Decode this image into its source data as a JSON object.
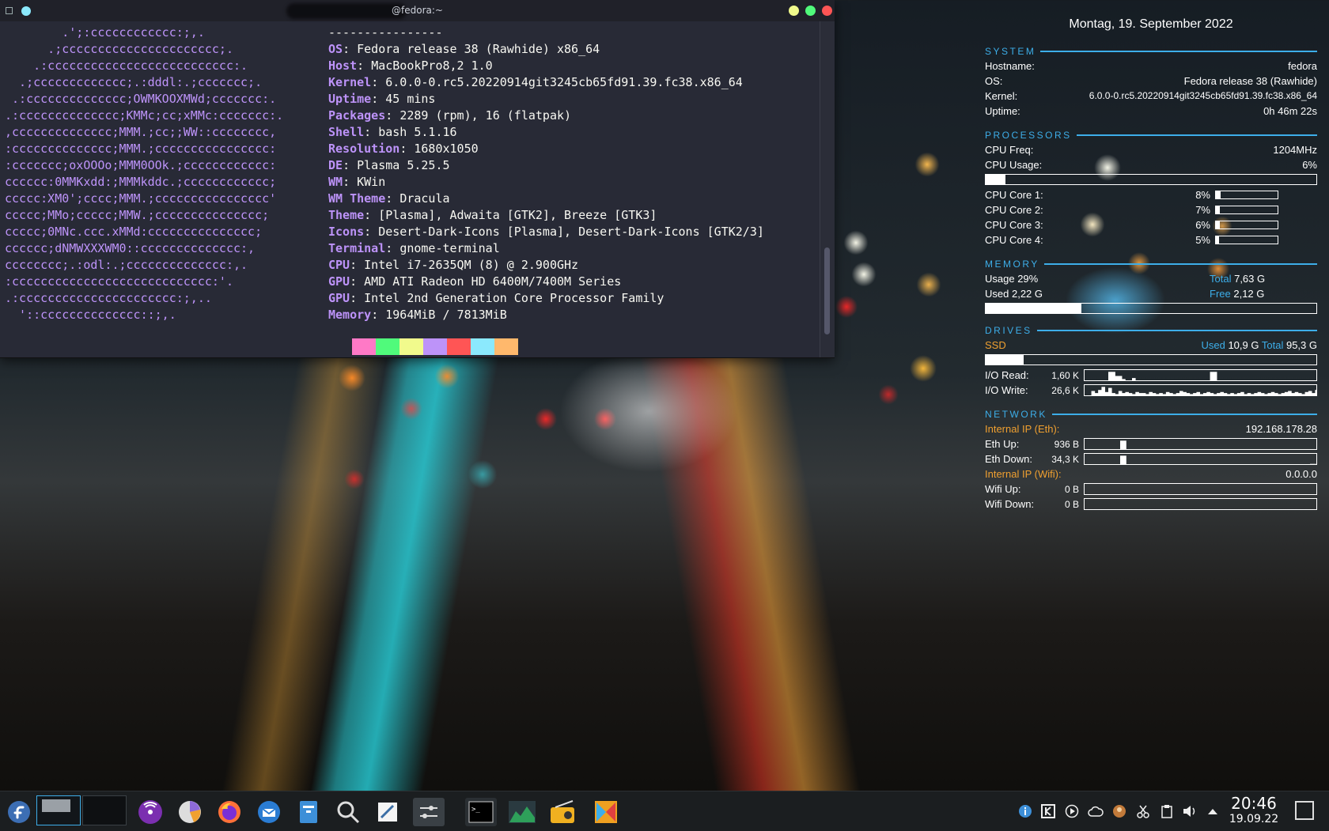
{
  "terminal": {
    "title": "@fedora:~",
    "separator": "----------------",
    "logo_lines": [
      "        .';:cccccccccccc:;,.",
      "      .;cccccccccccccccccccccc;.",
      "    .:cccccccccccccccccccccccccc:.",
      "  .;ccccccccccccc;.:dddl:.;ccccccc;.",
      " .:cccccccccccccc;OWMKOOXMWd;ccccccc:.",
      ".:cccccccccccccc;KMMc;cc;xMMc:ccccccc:.",
      ",cccccccccccccc;MMM.;cc;;WW::cccccccc,",
      ":cccccccccccccc;MMM.;cccccccccccccccc:",
      ":ccccccc;oxOOOo;MMM0OOk.;cccccccccccc:",
      "cccccc:0MMKxdd:;MMMkddc.;cccccccccccc;",
      "ccccc:XM0';cccc;MMM.;cccccccccccccccc'",
      "ccccc;MMo;ccccc;MMW.;ccccccccccccccc;",
      "ccccc;0MNc.ccc.xMMd:ccccccccccccccc;",
      "cccccc;dNMWXXXWM0::cccccccccccccc:,",
      "cccccccc;.:odl:.;cccccccccccccc:,.",
      ":cccccccccccccccccccccccccccc:'.",
      ".:cccccccccccccccccccccc:;,..",
      "  '::cccccccccccccc::;,."
    ],
    "info": [
      {
        "key": "OS",
        "value": "Fedora release 38 (Rawhide) x86_64"
      },
      {
        "key": "Host",
        "value": "MacBookPro8,2 1.0"
      },
      {
        "key": "Kernel",
        "value": "6.0.0-0.rc5.20220914git3245cb65fd91.39.fc38.x86_64"
      },
      {
        "key": "Uptime",
        "value": "45 mins"
      },
      {
        "key": "Packages",
        "value": "2289 (rpm), 16 (flatpak)"
      },
      {
        "key": "Shell",
        "value": "bash 5.1.16"
      },
      {
        "key": "Resolution",
        "value": "1680x1050"
      },
      {
        "key": "DE",
        "value": "Plasma 5.25.5"
      },
      {
        "key": "WM",
        "value": "KWin"
      },
      {
        "key": "WM Theme",
        "value": "Dracula"
      },
      {
        "key": "Theme",
        "value": "[Plasma], Adwaita [GTK2], Breeze [GTK3]"
      },
      {
        "key": "Icons",
        "value": "Desert-Dark-Icons [Plasma], Desert-Dark-Icons [GTK2/3]"
      },
      {
        "key": "Terminal",
        "value": "gnome-terminal"
      },
      {
        "key": "CPU",
        "value": "Intel i7-2635QM (8) @ 2.900GHz"
      },
      {
        "key": "GPU",
        "value": "AMD ATI Radeon HD 6400M/7400M Series"
      },
      {
        "key": "GPU",
        "value": "Intel 2nd Generation Core Processor Family"
      },
      {
        "key": "Memory",
        "value": "1964MiB / 7813MiB"
      }
    ],
    "palette": [
      "#282a36",
      "#ff79c6",
      "#50fa7b",
      "#f1fa8c",
      "#bd93f9",
      "#ff5555",
      "#8be9fd",
      "#ffb86c"
    ]
  },
  "conky": {
    "date": "Montag, 19. September 2022",
    "system": {
      "title": "SYSTEM",
      "hostname_label": "Hostname:",
      "hostname": "fedora",
      "os_label": "OS:",
      "os": "Fedora release 38 (Rawhide)",
      "kernel_label": "Kernel:",
      "kernel": "6.0.0-0.rc5.20220914git3245cb65fd91.39.fc38.x86_64",
      "uptime_label": "Uptime:",
      "uptime": "0h 46m 22s"
    },
    "processors": {
      "title": "PROCESSORS",
      "freq_label": "CPU Freq:",
      "freq": "1204MHz",
      "usage_label": "CPU Usage:",
      "usage": "6%",
      "usage_fraction": 0.06,
      "cores": [
        {
          "label": "CPU Core 1:",
          "value": "8%",
          "fraction": 0.08
        },
        {
          "label": "CPU Core 2:",
          "value": "7%",
          "fraction": 0.07
        },
        {
          "label": "CPU Core 3:",
          "value": "6%",
          "fraction": 0.06
        },
        {
          "label": "CPU Core 4:",
          "value": "5%",
          "fraction": 0.05
        }
      ]
    },
    "memory": {
      "title": "MEMORY",
      "usage_label": "Usage",
      "usage": "29%",
      "usage_fraction": 0.29,
      "total_label": "Total",
      "total": "7,63 G",
      "used_label": "Used",
      "used": "2,22 G",
      "free_label": "Free",
      "free": "2,12 G"
    },
    "drives": {
      "title": "DRIVES",
      "ssd_label": "SSD",
      "used_label": "Used",
      "used": "10,9 G",
      "total_label": "Total",
      "total": "95,3 G",
      "usage_fraction": 0.114,
      "io_read_label": "I/O Read:",
      "io_read": "1,60 K",
      "io_write_label": "I/O Write:",
      "io_write": "26,6 K",
      "io_read_graph": [
        0,
        0,
        0,
        0,
        0,
        0,
        0,
        0.9,
        0.9,
        0.5,
        0.5,
        0.2,
        0,
        0,
        0.3,
        0,
        0,
        0,
        0,
        0,
        0,
        0,
        0,
        0,
        0,
        0,
        0,
        0,
        0,
        0,
        0,
        0,
        0,
        0,
        0,
        0,
        0,
        0.9,
        0.9,
        0,
        0,
        0,
        0,
        0,
        0,
        0,
        0,
        0,
        0,
        0,
        0,
        0,
        0,
        0,
        0,
        0,
        0,
        0,
        0,
        0,
        0,
        0,
        0,
        0,
        0,
        0,
        0,
        0,
        0,
        0
      ],
      "io_write_graph": [
        0,
        0,
        0.5,
        0.3,
        0.6,
        0.9,
        0.4,
        0.8,
        0.3,
        0.2,
        0.5,
        0.3,
        0.4,
        0.3,
        0.2,
        0.4,
        0.3,
        0.3,
        0.2,
        0.4,
        0.3,
        0.2,
        0.3,
        0.2,
        0.4,
        0.3,
        0.2,
        0.3,
        0.5,
        0.4,
        0.3,
        0.2,
        0.3,
        0.4,
        0.2,
        0.3,
        0.4,
        0.3,
        0.2,
        0.3,
        0.4,
        0.3,
        0.2,
        0.3,
        0.2,
        0.3,
        0.4,
        0.2,
        0.3,
        0.2,
        0.3,
        0.4,
        0.3,
        0.2,
        0.3,
        0.4,
        0.3,
        0.2,
        0.3,
        0.4,
        0.5,
        0.3,
        0.4,
        0.3,
        0.2,
        0.4,
        0.5,
        0.3,
        0.6,
        0.4
      ]
    },
    "network": {
      "title": "NETWORK",
      "eth_ip_label": "Internal IP (Eth):",
      "eth_ip": "192.168.178.28",
      "eth_up_label": "Eth Up:",
      "eth_up": "936 B",
      "eth_down_label": "Eth Down:",
      "eth_down": "34,3 K",
      "wifi_ip_label": "Internal IP (Wifi):",
      "wifi_ip": "0.0.0.0",
      "wifi_up_label": "Wifi Up:",
      "wifi_up": "0 B",
      "wifi_down_label": "Wifi Down:",
      "wifi_down": "0 B",
      "eth_up_graph": [
        0,
        0,
        0,
        0,
        0,
        0,
        0.9,
        0,
        0,
        0,
        0,
        0,
        0,
        0,
        0,
        0,
        0,
        0,
        0,
        0,
        0,
        0,
        0,
        0,
        0,
        0,
        0,
        0,
        0,
        0,
        0,
        0,
        0,
        0,
        0,
        0,
        0,
        0,
        0,
        0
      ],
      "eth_down_graph": [
        0,
        0,
        0,
        0,
        0,
        0,
        0.9,
        0,
        0,
        0,
        0,
        0,
        0,
        0,
        0,
        0,
        0,
        0,
        0,
        0,
        0,
        0,
        0,
        0,
        0,
        0,
        0,
        0,
        0,
        0,
        0,
        0,
        0,
        0,
        0,
        0,
        0,
        0,
        0.1,
        0
      ]
    },
    "colors": {
      "accent": "#3daee9",
      "highlight": "#f0a030"
    }
  },
  "taskbar": {
    "clock_time": "20:46",
    "clock_date": "19.09.22",
    "launchers": [
      "fedora-logo-icon",
      "podcast-icon",
      "disk-usage-icon",
      "firefox-icon",
      "thunderbird-icon",
      "file-manager-icon",
      "search-icon",
      "text-editor-icon",
      "mixer-icon",
      "terminal-icon",
      "system-monitor-icon",
      "radio-icon",
      "kdenlive-icon"
    ],
    "tray": [
      "info-icon",
      "kde-connect-icon",
      "media-play-icon",
      "cloud-icon",
      "avatar-icon",
      "scissors-icon",
      "clipboard-icon",
      "volume-icon",
      "tray-expand-icon"
    ]
  }
}
